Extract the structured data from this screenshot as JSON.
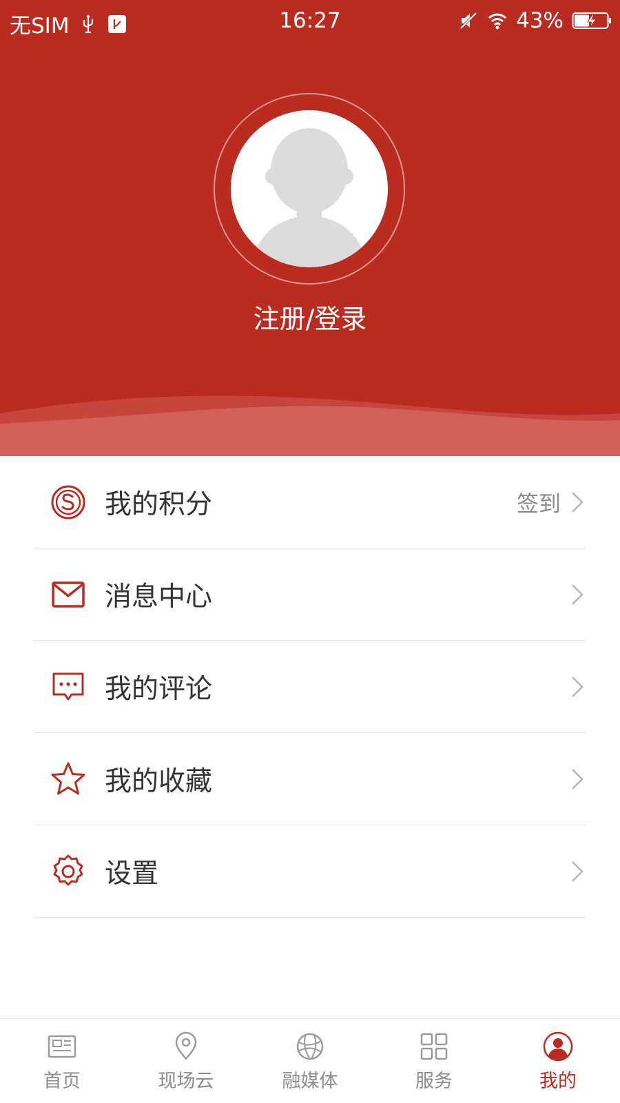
{
  "status_bar": {
    "carrier": "无SIM",
    "time": "16:27",
    "battery_percent": "43%"
  },
  "profile": {
    "login_label": "注册/登录"
  },
  "menu": {
    "items": [
      {
        "label": "我的积分",
        "extra": "签到",
        "icon": "points-icon"
      },
      {
        "label": "消息中心",
        "icon": "envelope-icon"
      },
      {
        "label": "我的评论",
        "icon": "comment-icon"
      },
      {
        "label": "我的收藏",
        "icon": "star-icon"
      },
      {
        "label": "设置",
        "icon": "gear-icon"
      }
    ]
  },
  "tabbar": {
    "items": [
      {
        "label": "首页",
        "icon": "newspaper-icon"
      },
      {
        "label": "现场云",
        "icon": "location-pin-icon"
      },
      {
        "label": "融媒体",
        "icon": "globe-icon"
      },
      {
        "label": "服务",
        "icon": "grid-icon"
      },
      {
        "label": "我的",
        "icon": "user-avatar-icon",
        "active": true
      }
    ]
  },
  "colors": {
    "brand_red": "#BA2B20",
    "text_dark": "#333333",
    "text_gray": "#8C8C8C"
  }
}
